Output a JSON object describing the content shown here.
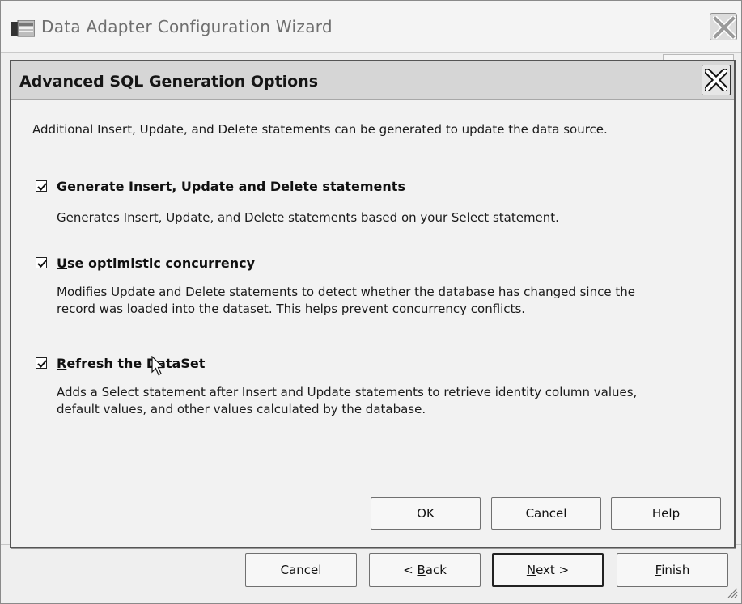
{
  "wizard": {
    "title": "Data Adapter Configuration Wizard",
    "buttons": {
      "cancel": "Cancel",
      "back_prefix": "< ",
      "back_mnemonic": "B",
      "back_rest": "ack",
      "next_mnemonic": "N",
      "next_rest": "ext >",
      "finish_mnemonic": "F",
      "finish_rest": "inish"
    }
  },
  "dialog": {
    "title": "Advanced SQL Generation Options",
    "intro": "Additional  Insert, Update, and Delete statements can be generated to update the data source.",
    "options": [
      {
        "checked": true,
        "mnemonic": "G",
        "label_rest": "enerate Insert, Update and Delete statements",
        "description": [
          "Generates Insert, Update, and Delete statements based on your Select statement."
        ]
      },
      {
        "checked": true,
        "mnemonic": "U",
        "label_rest": "se optimistic concurrency",
        "description": [
          "Modifies Update and Delete statements to detect whether the database has changed since the",
          "record was loaded into the dataset. This helps prevent concurrency conflicts."
        ]
      },
      {
        "checked": true,
        "mnemonic": "R",
        "label_rest": "efresh the DataSet",
        "description": [
          "Adds a Select statement after Insert and Update statements to retrieve identity column values,",
          "default values, and other values calculated by the database."
        ]
      }
    ],
    "buttons": {
      "ok": "OK",
      "cancel": "Cancel",
      "help": "Help"
    }
  }
}
